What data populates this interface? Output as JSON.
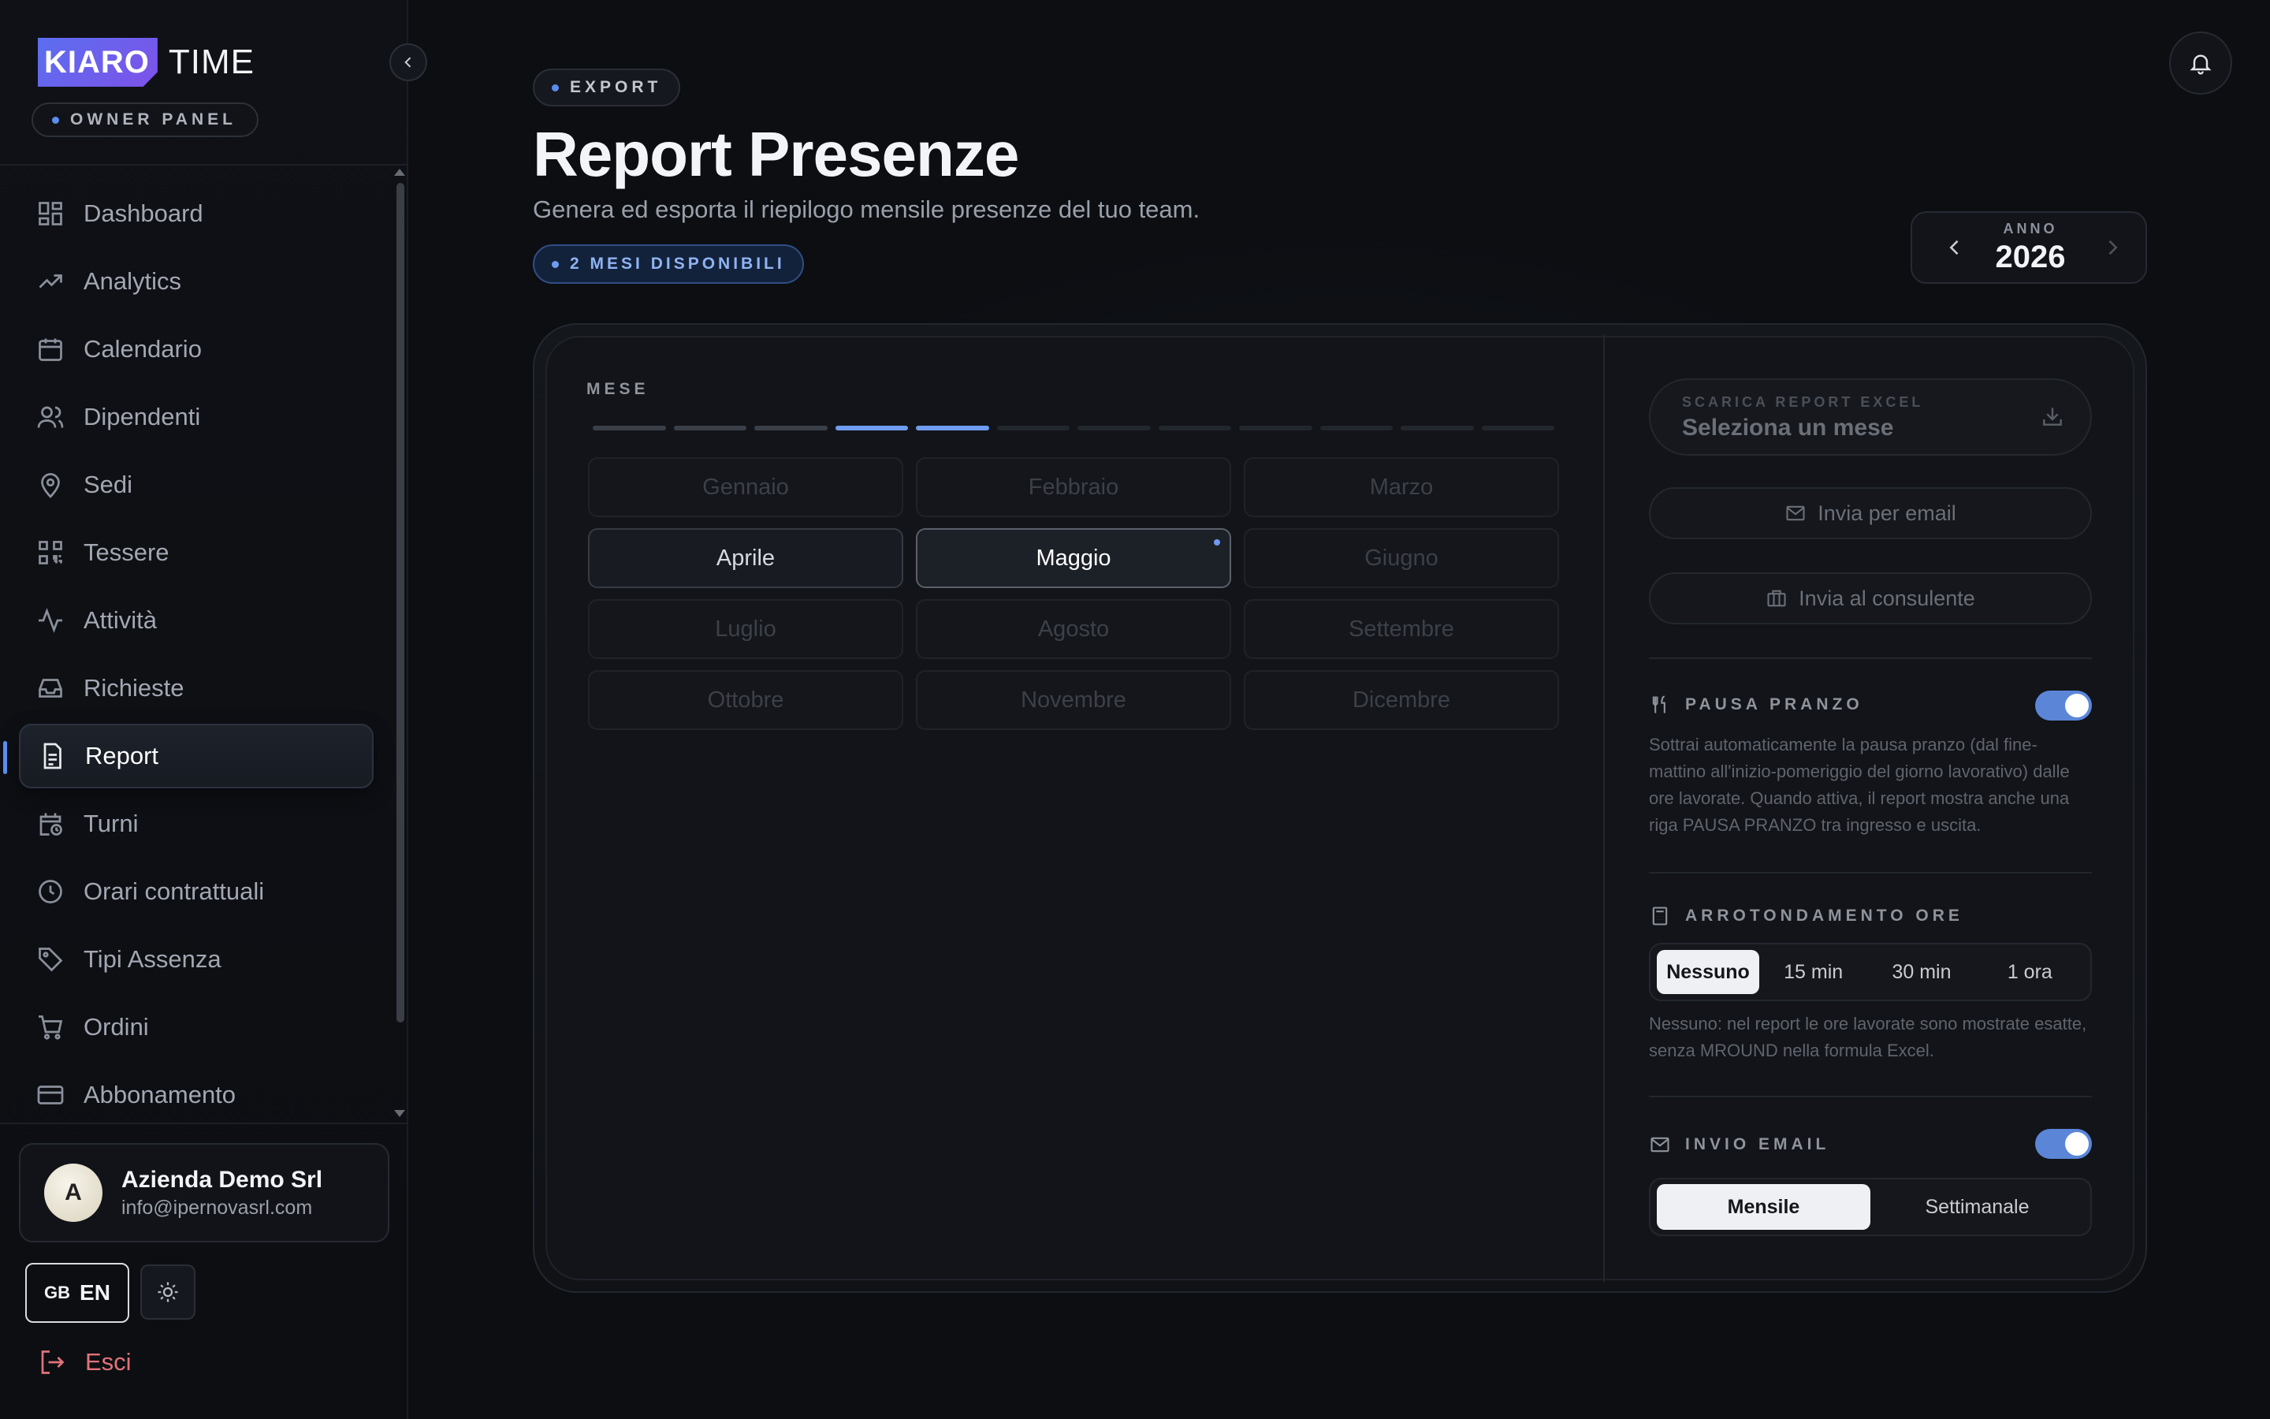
{
  "brand": {
    "badge": "KIARO",
    "name": "TIME"
  },
  "panel_label": "OWNER PANEL",
  "sidebar": {
    "items": [
      {
        "label": "Dashboard",
        "icon": "dashboard-icon"
      },
      {
        "label": "Analytics",
        "icon": "trending-up-icon"
      },
      {
        "label": "Calendario",
        "icon": "calendar-icon"
      },
      {
        "label": "Dipendenti",
        "icon": "users-icon"
      },
      {
        "label": "Sedi",
        "icon": "map-pin-icon"
      },
      {
        "label": "Tessere",
        "icon": "qr-code-icon"
      },
      {
        "label": "Attività",
        "icon": "activity-icon"
      },
      {
        "label": "Richieste",
        "icon": "inbox-icon"
      },
      {
        "label": "Report",
        "icon": "file-report-icon",
        "active": true
      },
      {
        "label": "Turni",
        "icon": "calendar-clock-icon"
      },
      {
        "label": "Orari contrattuali",
        "icon": "clock-icon"
      },
      {
        "label": "Tipi Assenza",
        "icon": "tag-icon"
      },
      {
        "label": "Ordini",
        "icon": "cart-icon"
      },
      {
        "label": "Abbonamento",
        "icon": "credit-card-icon"
      }
    ]
  },
  "user": {
    "initial": "A",
    "name": "Azienda Demo Srl",
    "email": "info@ipernovasrl.com"
  },
  "language": {
    "flag": "GB",
    "code": "EN"
  },
  "logout_label": "Esci",
  "header": {
    "eyebrow": "EXPORT",
    "title": "Report Presenze",
    "subtitle": "Genera ed esporta il riepilogo mensile presenze del tuo team.",
    "months_badge": "2 MESI DISPONIBILI"
  },
  "year_selector": {
    "label": "ANNO",
    "value": "2026"
  },
  "month_picker": {
    "label": "MESE",
    "months": [
      {
        "name": "Gennaio",
        "state": "disabled"
      },
      {
        "name": "Febbraio",
        "state": "disabled"
      },
      {
        "name": "Marzo",
        "state": "disabled"
      },
      {
        "name": "Aprile",
        "state": "available"
      },
      {
        "name": "Maggio",
        "state": "selected"
      },
      {
        "name": "Giugno",
        "state": "disabled"
      },
      {
        "name": "Luglio",
        "state": "disabled"
      },
      {
        "name": "Agosto",
        "state": "disabled"
      },
      {
        "name": "Settembre",
        "state": "disabled"
      },
      {
        "name": "Ottobre",
        "state": "disabled"
      },
      {
        "name": "Novembre",
        "state": "disabled"
      },
      {
        "name": "Dicembre",
        "state": "disabled"
      }
    ]
  },
  "download": {
    "label": "SCARICA REPORT EXCEL",
    "value": "Seleziona un mese"
  },
  "actions": {
    "email": "Invia per email",
    "consultant": "Invia al consulente"
  },
  "lunch_break": {
    "title": "PAUSA PRANZO",
    "enabled": true,
    "description": "Sottrai automaticamente la pausa pranzo (dal fine-mattino all'inizio-pomeriggio del giorno lavorativo) dalle ore lavorate. Quando attiva, il report mostra anche una riga PAUSA PRANZO tra ingresso e uscita."
  },
  "rounding": {
    "title": "ARROTONDAMENTO ORE",
    "options": [
      "Nessuno",
      "15 min",
      "30 min",
      "1 ora"
    ],
    "selected": "Nessuno",
    "description": "Nessuno: nel report le ore lavorate sono mostrate esatte, senza MROUND nella formula Excel."
  },
  "email_send": {
    "title": "INVIO EMAIL",
    "enabled": true,
    "options": [
      "Mensile",
      "Settimanale"
    ],
    "selected": "Mensile"
  },
  "colors": {
    "accent": "#5b8df0",
    "toggle": "#5b86d8",
    "logout": "#e0737a"
  }
}
